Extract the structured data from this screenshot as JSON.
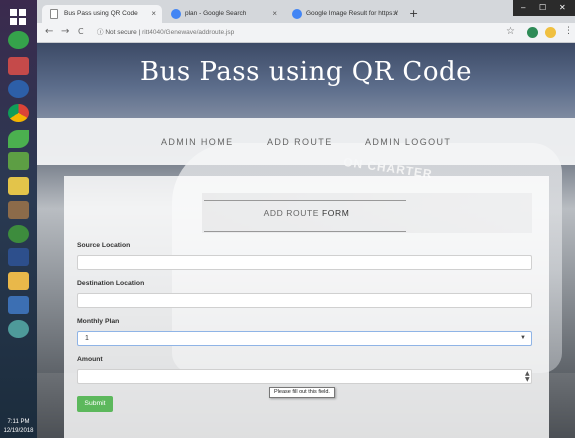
{
  "taskbar": {
    "icons": [
      "start-icon",
      "app-icon",
      "paint-icon",
      "media-icon",
      "chrome-icon",
      "leaf-icon",
      "tools-icon",
      "books-icon",
      "people-icon",
      "hs-icon",
      "pen-icon",
      "folder-icon",
      "notes-icon",
      "globe-icon"
    ],
    "clock_time": "7:11 PM",
    "clock_date": "12/19/2018"
  },
  "browser": {
    "tabs": [
      {
        "title": "Bus Pass using QR Code",
        "close": "×"
      },
      {
        "title": "plan - Google Search",
        "close": "×"
      },
      {
        "title": "Google Image Result for https://",
        "close": "×"
      }
    ],
    "new_tab": "+",
    "window_controls": [
      "–",
      "☐",
      "✕"
    ],
    "back": "←",
    "forward": "→",
    "reload": "C",
    "security_label": "Not secure",
    "url": "ritt4040/Genewave/addroute.jsp"
  },
  "hero": {
    "title": "Bus Pass using QR Code"
  },
  "nav": {
    "home": "ADMIN HOME",
    "add_route": "ADD ROUTE",
    "logout": "ADMIN LOGOUT"
  },
  "background": {
    "bus_sign": "ON CHARTER"
  },
  "form": {
    "heading_light": "ADD ROUTE ",
    "heading_strong": "FORM",
    "source_label": "Source Location",
    "source_value": "",
    "destination_label": "Destination Location",
    "destination_value": "",
    "plan_label": "Monthly Plan",
    "plan_selected": "1",
    "amount_label": "Amount",
    "amount_value": "",
    "submit_label": "Submit",
    "validation_tooltip": "Please fill out this field."
  }
}
